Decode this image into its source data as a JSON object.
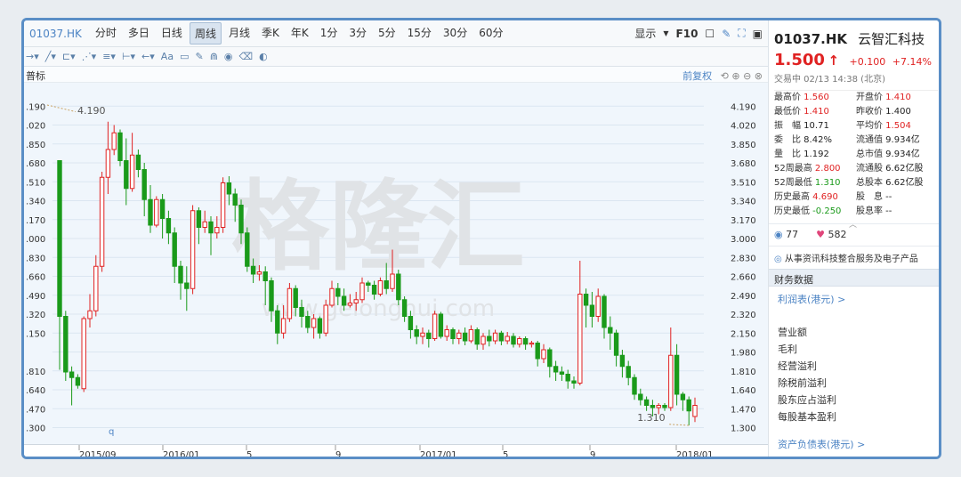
{
  "toolbar": {
    "code": "01037.HK",
    "periods": [
      "分时",
      "多日",
      "日线",
      "周线",
      "月线",
      "季K",
      "年K",
      "1分",
      "3分",
      "5分",
      "15分",
      "30分",
      "60分"
    ],
    "active_period": "周线",
    "display": "显示",
    "f10": "F10",
    "tools": [
      "→▾",
      "╱▾",
      "⊏▾",
      "⋰▾",
      "≡▾",
      "⊢▾",
      "←▾",
      "Aa",
      "▭",
      "✎",
      "⋒",
      "◉",
      "⌫",
      "◐"
    ]
  },
  "chart_area": {
    "indicator_label": "普标",
    "adjust_label": "前复权",
    "watermark": "格隆汇",
    "watermark_url": "www.gelonghui.com",
    "max_annot": "4.190",
    "min_annot": "1.310",
    "left_prefix_q": "q"
  },
  "chart_data": {
    "type": "candlestick",
    "ylim": [
      1.2,
      4.32
    ],
    "y_ticks_right": [
      "4.190",
      "4.020",
      "3.850",
      "3.680",
      "3.510",
      "3.340",
      "3.170",
      "3.000",
      "2.830",
      "2.660",
      "2.490",
      "2.320",
      "2.150",
      "1.980",
      "1.810",
      "1.640",
      "1.470",
      "1.300"
    ],
    "y_ticks_left": [
      ".190",
      ".020",
      ".850",
      ".680",
      ".510",
      ".340",
      ".170",
      ".000",
      ".830",
      ".660",
      ".490",
      ".320",
      ".150",
      ".810",
      ".640",
      ".470",
      ".300"
    ],
    "x_labels": [
      "2015/09",
      "2016/01",
      "5",
      "9",
      "2017/01",
      "5",
      "9",
      "2018/01"
    ],
    "up_color": "#e02222",
    "down_color": "#1a9a1a",
    "candles": [
      {
        "o": 3.7,
        "c": 2.3,
        "h": 3.7,
        "l": 1.82
      },
      {
        "o": 2.3,
        "c": 1.8,
        "h": 2.35,
        "l": 1.72
      },
      {
        "o": 1.8,
        "c": 1.75,
        "h": 1.85,
        "l": 1.5
      },
      {
        "o": 1.75,
        "c": 1.68,
        "h": 1.78,
        "l": 1.65
      },
      {
        "o": 1.65,
        "c": 2.28,
        "h": 2.3,
        "l": 1.62
      },
      {
        "o": 2.28,
        "c": 2.35,
        "h": 2.5,
        "l": 2.2
      },
      {
        "o": 2.35,
        "c": 2.75,
        "h": 2.85,
        "l": 2.3
      },
      {
        "o": 2.75,
        "c": 3.55,
        "h": 3.6,
        "l": 2.7
      },
      {
        "o": 3.55,
        "c": 3.8,
        "h": 4.05,
        "l": 3.4
      },
      {
        "o": 3.8,
        "c": 3.95,
        "h": 4.02,
        "l": 3.75
      },
      {
        "o": 3.95,
        "c": 3.7,
        "h": 3.98,
        "l": 3.65
      },
      {
        "o": 3.7,
        "c": 3.45,
        "h": 3.9,
        "l": 3.3
      },
      {
        "o": 3.45,
        "c": 3.75,
        "h": 3.95,
        "l": 3.42
      },
      {
        "o": 3.75,
        "c": 3.62,
        "h": 3.8,
        "l": 3.55
      },
      {
        "o": 3.62,
        "c": 3.35,
        "h": 3.68,
        "l": 3.2
      },
      {
        "o": 3.35,
        "c": 3.12,
        "h": 3.48,
        "l": 3.05
      },
      {
        "o": 3.12,
        "c": 3.35,
        "h": 3.38,
        "l": 3.1
      },
      {
        "o": 3.35,
        "c": 3.18,
        "h": 3.4,
        "l": 3.0
      },
      {
        "o": 3.18,
        "c": 3.05,
        "h": 3.25,
        "l": 2.95
      },
      {
        "o": 3.05,
        "c": 2.75,
        "h": 3.1,
        "l": 2.6
      },
      {
        "o": 2.75,
        "c": 2.6,
        "h": 2.8,
        "l": 2.45
      },
      {
        "o": 2.6,
        "c": 2.55,
        "h": 2.75,
        "l": 2.35
      },
      {
        "o": 2.55,
        "c": 3.25,
        "h": 3.3,
        "l": 2.5
      },
      {
        "o": 3.25,
        "c": 3.1,
        "h": 3.28,
        "l": 2.95
      },
      {
        "o": 3.1,
        "c": 3.15,
        "h": 3.25,
        "l": 3.05
      },
      {
        "o": 3.15,
        "c": 3.05,
        "h": 3.2,
        "l": 2.85
      },
      {
        "o": 3.05,
        "c": 3.1,
        "h": 3.2,
        "l": 3.0
      },
      {
        "o": 3.1,
        "c": 3.5,
        "h": 3.55,
        "l": 3.05
      },
      {
        "o": 3.5,
        "c": 3.4,
        "h": 3.56,
        "l": 3.3
      },
      {
        "o": 3.4,
        "c": 3.3,
        "h": 3.45,
        "l": 3.15
      },
      {
        "o": 3.3,
        "c": 3.05,
        "h": 3.35,
        "l": 2.95
      },
      {
        "o": 3.05,
        "c": 2.75,
        "h": 3.1,
        "l": 2.7
      },
      {
        "o": 2.75,
        "c": 2.68,
        "h": 2.82,
        "l": 2.6
      },
      {
        "o": 2.68,
        "c": 2.7,
        "h": 2.76,
        "l": 2.62
      },
      {
        "o": 2.7,
        "c": 2.62,
        "h": 2.75,
        "l": 2.4
      },
      {
        "o": 2.62,
        "c": 2.35,
        "h": 2.65,
        "l": 2.25
      },
      {
        "o": 2.35,
        "c": 2.15,
        "h": 2.4,
        "l": 2.05
      },
      {
        "o": 2.15,
        "c": 2.28,
        "h": 2.4,
        "l": 2.1
      },
      {
        "o": 2.28,
        "c": 2.55,
        "h": 2.6,
        "l": 2.25
      },
      {
        "o": 2.55,
        "c": 2.38,
        "h": 2.58,
        "l": 2.3
      },
      {
        "o": 2.38,
        "c": 2.3,
        "h": 2.45,
        "l": 2.2
      },
      {
        "o": 2.3,
        "c": 2.2,
        "h": 2.35,
        "l": 2.15
      },
      {
        "o": 2.2,
        "c": 2.28,
        "h": 2.32,
        "l": 2.1
      },
      {
        "o": 2.28,
        "c": 2.15,
        "h": 2.3,
        "l": 2.1
      },
      {
        "o": 2.15,
        "c": 2.4,
        "h": 2.45,
        "l": 2.12
      },
      {
        "o": 2.4,
        "c": 2.55,
        "h": 2.62,
        "l": 2.38
      },
      {
        "o": 2.55,
        "c": 2.48,
        "h": 2.6,
        "l": 2.4
      },
      {
        "o": 2.48,
        "c": 2.4,
        "h": 2.55,
        "l": 2.35
      },
      {
        "o": 2.4,
        "c": 2.42,
        "h": 2.5,
        "l": 2.38
      },
      {
        "o": 2.42,
        "c": 2.45,
        "h": 2.52,
        "l": 2.35
      },
      {
        "o": 2.45,
        "c": 2.6,
        "h": 2.65,
        "l": 2.42
      },
      {
        "o": 2.6,
        "c": 2.58,
        "h": 2.62,
        "l": 2.52
      },
      {
        "o": 2.58,
        "c": 2.5,
        "h": 2.62,
        "l": 2.45
      },
      {
        "o": 2.5,
        "c": 2.62,
        "h": 2.65,
        "l": 2.48
      },
      {
        "o": 2.62,
        "c": 2.55,
        "h": 2.78,
        "l": 2.5
      },
      {
        "o": 2.55,
        "c": 2.68,
        "h": 2.9,
        "l": 2.52
      },
      {
        "o": 2.68,
        "c": 2.45,
        "h": 2.72,
        "l": 2.4
      },
      {
        "o": 2.45,
        "c": 2.3,
        "h": 2.48,
        "l": 2.25
      },
      {
        "o": 2.3,
        "c": 2.18,
        "h": 2.35,
        "l": 2.1
      },
      {
        "o": 2.18,
        "c": 2.12,
        "h": 2.22,
        "l": 2.05
      },
      {
        "o": 2.12,
        "c": 2.15,
        "h": 2.2,
        "l": 2.05
      },
      {
        "o": 2.15,
        "c": 2.1,
        "h": 2.18,
        "l": 2.02
      },
      {
        "o": 2.1,
        "c": 2.32,
        "h": 2.35,
        "l": 2.08
      },
      {
        "o": 2.32,
        "c": 2.12,
        "h": 2.34,
        "l": 2.1
      },
      {
        "o": 2.12,
        "c": 2.18,
        "h": 2.22,
        "l": 2.08
      },
      {
        "o": 2.18,
        "c": 2.1,
        "h": 2.2,
        "l": 2.05
      },
      {
        "o": 2.1,
        "c": 2.15,
        "h": 2.18,
        "l": 2.05
      },
      {
        "o": 2.15,
        "c": 2.08,
        "h": 2.2,
        "l": 2.04
      },
      {
        "o": 2.08,
        "c": 2.18,
        "h": 2.22,
        "l": 2.06
      },
      {
        "o": 2.18,
        "c": 2.05,
        "h": 2.2,
        "l": 2.0
      },
      {
        "o": 2.05,
        "c": 2.12,
        "h": 2.15,
        "l": 2.0
      },
      {
        "o": 2.12,
        "c": 2.08,
        "h": 2.18,
        "l": 2.03
      },
      {
        "o": 2.08,
        "c": 2.15,
        "h": 2.18,
        "l": 2.05
      },
      {
        "o": 2.15,
        "c": 2.08,
        "h": 2.17,
        "l": 2.04
      },
      {
        "o": 2.08,
        "c": 2.12,
        "h": 2.16,
        "l": 2.05
      },
      {
        "o": 2.12,
        "c": 2.05,
        "h": 2.15,
        "l": 2.02
      },
      {
        "o": 2.05,
        "c": 2.1,
        "h": 2.12,
        "l": 2.02
      },
      {
        "o": 2.1,
        "c": 2.05,
        "h": 2.12,
        "l": 2.0
      },
      {
        "o": 2.05,
        "c": 2.06,
        "h": 2.08,
        "l": 2.02
      },
      {
        "o": 2.06,
        "c": 1.92,
        "h": 2.08,
        "l": 1.85
      },
      {
        "o": 1.92,
        "c": 2.0,
        "h": 2.05,
        "l": 1.88
      },
      {
        "o": 2.0,
        "c": 1.85,
        "h": 2.02,
        "l": 1.75
      },
      {
        "o": 1.85,
        "c": 1.8,
        "h": 1.9,
        "l": 1.72
      },
      {
        "o": 1.8,
        "c": 1.78,
        "h": 1.85,
        "l": 1.72
      },
      {
        "o": 1.78,
        "c": 1.72,
        "h": 1.82,
        "l": 1.65
      },
      {
        "o": 1.72,
        "c": 1.7,
        "h": 1.76,
        "l": 1.65
      },
      {
        "o": 1.7,
        "c": 2.5,
        "h": 2.8,
        "l": 1.68
      },
      {
        "o": 2.5,
        "c": 2.4,
        "h": 2.55,
        "l": 2.2
      },
      {
        "o": 2.4,
        "c": 2.3,
        "h": 2.52,
        "l": 2.2
      },
      {
        "o": 2.3,
        "c": 2.48,
        "h": 2.55,
        "l": 2.25
      },
      {
        "o": 2.48,
        "c": 2.2,
        "h": 2.5,
        "l": 2.1
      },
      {
        "o": 2.2,
        "c": 2.15,
        "h": 2.3,
        "l": 2.0
      },
      {
        "o": 2.15,
        "c": 1.95,
        "h": 2.18,
        "l": 1.85
      },
      {
        "o": 1.95,
        "c": 1.85,
        "h": 2.0,
        "l": 1.75
      },
      {
        "o": 1.85,
        "c": 1.75,
        "h": 1.9,
        "l": 1.68
      },
      {
        "o": 1.75,
        "c": 1.6,
        "h": 1.78,
        "l": 1.55
      },
      {
        "o": 1.6,
        "c": 1.55,
        "h": 1.65,
        "l": 1.5
      },
      {
        "o": 1.55,
        "c": 1.5,
        "h": 1.58,
        "l": 1.45
      },
      {
        "o": 1.5,
        "c": 1.48,
        "h": 1.55,
        "l": 1.4
      },
      {
        "o": 1.48,
        "c": 1.5,
        "h": 1.52,
        "l": 1.42
      },
      {
        "o": 1.5,
        "c": 1.48,
        "h": 1.52,
        "l": 1.45
      },
      {
        "o": 1.48,
        "c": 1.95,
        "h": 2.2,
        "l": 1.45
      },
      {
        "o": 1.95,
        "c": 1.6,
        "h": 2.05,
        "l": 1.5
      },
      {
        "o": 1.6,
        "c": 1.55,
        "h": 1.62,
        "l": 1.45
      },
      {
        "o": 1.55,
        "c": 1.45,
        "h": 1.58,
        "l": 1.32
      },
      {
        "o": 1.4,
        "c": 1.5,
        "h": 1.57,
        "l": 1.35
      }
    ]
  },
  "side": {
    "code": "01037.HK",
    "name": "云智汇科技",
    "price": "1.500",
    "arrow": "↑",
    "change": "+0.100",
    "change_pct": "+7.14%",
    "trade_time": "交易中 02/13 14:38 (北京)",
    "stats": [
      {
        "l": "最高价",
        "v": "1.560",
        "c": "up",
        "l2": "开盘价",
        "v2": "1.410",
        "c2": "up"
      },
      {
        "l": "最低价",
        "v": "1.410",
        "c": "up",
        "l2": "昨收价",
        "v2": "1.400",
        "c2": ""
      },
      {
        "l": "振　幅",
        "v": "10.71",
        "c": "",
        "l2": "平均价",
        "v2": "1.504",
        "c2": "up"
      },
      {
        "l": "委　比",
        "v": "8.42%",
        "c": "",
        "l2": "流通值",
        "v2": "9.934亿",
        "c2": ""
      },
      {
        "l": "量　比",
        "v": "1.192",
        "c": "",
        "l2": "总市值",
        "v2": "9.934亿",
        "c2": ""
      },
      {
        "l": "52周最高",
        "v": "2.800",
        "c": "up",
        "l2": "流通股",
        "v2": "6.62亿股",
        "c2": ""
      },
      {
        "l": "52周最低",
        "v": "1.310",
        "c": "dn",
        "l2": "总股本",
        "v2": "6.62亿股",
        "c2": ""
      },
      {
        "l": "历史最高",
        "v": "4.690",
        "c": "up",
        "l2": "股　息",
        "v2": "--",
        "c2": ""
      },
      {
        "l": "历史最低",
        "v": "-0.250",
        "c": "dn",
        "l2": "股息率",
        "v2": "--",
        "c2": ""
      }
    ],
    "views": "77",
    "likes": "582",
    "business": "从事资讯科技整合服务及电子产品",
    "finance_title": "财务数据",
    "income_link": "利润表(港元) >",
    "items": [
      "营业额",
      "毛利",
      "经营溢利",
      "除税前溢利",
      "股东应占溢利",
      "每股基本盈利"
    ],
    "balance_link": "资产负债表(港元) >"
  }
}
